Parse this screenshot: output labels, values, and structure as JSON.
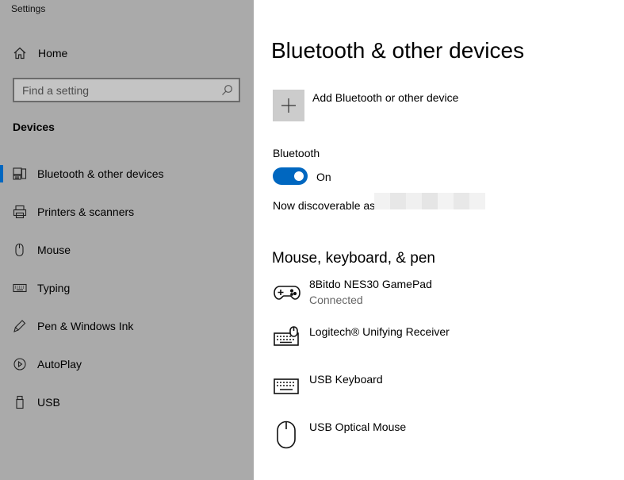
{
  "app": {
    "title": "Settings"
  },
  "sidebar": {
    "home_label": "Home",
    "search_placeholder": "Find a setting",
    "section_title": "Devices",
    "items": [
      {
        "label": "Bluetooth & other devices",
        "icon": "bluetooth-devices-icon",
        "selected": true
      },
      {
        "label": "Printers & scanners",
        "icon": "printer-icon"
      },
      {
        "label": "Mouse",
        "icon": "mouse-icon"
      },
      {
        "label": "Typing",
        "icon": "keyboard-icon"
      },
      {
        "label": "Pen & Windows Ink",
        "icon": "pen-icon"
      },
      {
        "label": "AutoPlay",
        "icon": "autoplay-icon"
      },
      {
        "label": "USB",
        "icon": "usb-icon"
      }
    ]
  },
  "main": {
    "title": "Bluetooth & other devices",
    "add_device_label": "Add Bluetooth or other device",
    "bluetooth": {
      "heading": "Bluetooth",
      "state": "On",
      "discoverable_label": "Now discoverable as"
    },
    "mkp": {
      "title": "Mouse, keyboard, & pen",
      "devices": [
        {
          "name": "8Bitdo NES30 GamePad",
          "status": "Connected",
          "icon": "gamepad-icon"
        },
        {
          "name": "Logitech® Unifying Receiver",
          "status": "",
          "icon": "keyboard-mouse-icon"
        },
        {
          "name": "USB Keyboard",
          "status": "",
          "icon": "keyboard-icon"
        },
        {
          "name": "USB Optical Mouse",
          "status": "",
          "icon": "mouse-icon"
        }
      ]
    }
  },
  "colors": {
    "accent": "#0067c0",
    "sidebar_bg": "#aaaaaa",
    "main_bg": "#ffffff"
  }
}
